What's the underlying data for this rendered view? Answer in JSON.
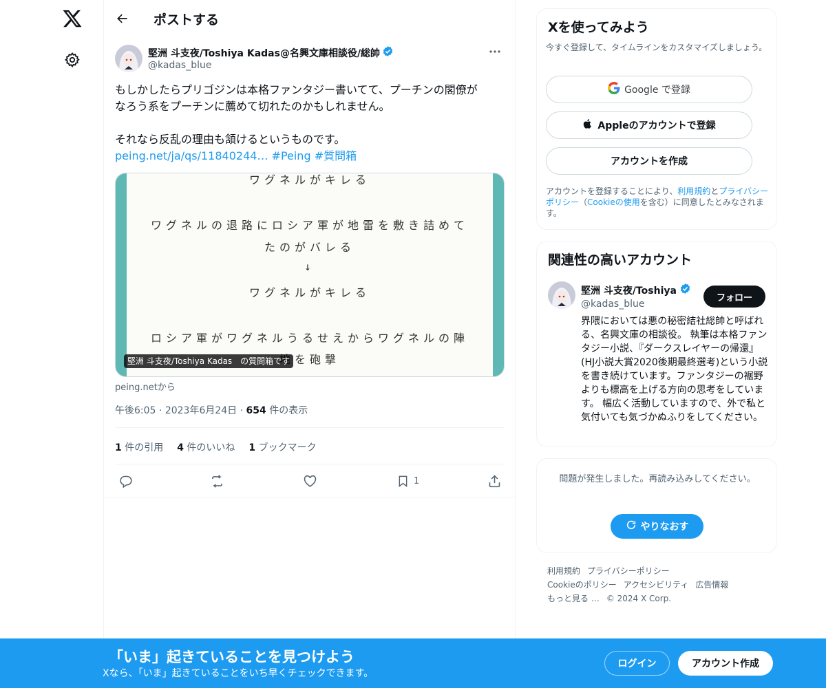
{
  "header": {
    "title": "ポストする"
  },
  "tweet": {
    "author_name": "堅洲 斗支夜/Toshiya Kadas@名興文庫相談役/総帥",
    "author_handle": "@kadas_blue",
    "text_line1": "もしかしたらプリゴジンは本格ファンタジー書いてて、プーチンの閣僚が",
    "text_line2": "なろう系をプーチンに薦めて切れたのかもしれません。",
    "text_line3": "それなら反乱の理由も頷けるというものです。",
    "link": "peing.net/ja/qs/11840244…",
    "hashtag1": "#Peing",
    "hashtag2": "#質問箱",
    "card": {
      "hw_lines": [
        "ワグネルがキレる",
        "ワグネルの退路にロシア軍が地雷を敷き詰めて",
        "たのがバレる",
        "↓",
        "ワグネルがキレる",
        "ロシア軍がワグネルうるせえからワグネルの陣",
        "地を砲撃"
      ],
      "caption": "堅洲 斗支夜/Toshiya Kadas　の質問箱です",
      "source": "peing.netから"
    },
    "time": "午後6:05",
    "date": "2023年6月24日",
    "views_count": "654",
    "views_label": "件の表示",
    "quotes_count": "1",
    "quotes_label": "件の引用",
    "likes_count": "4",
    "likes_label": "件のいいね",
    "bookmarks_count": "1",
    "bookmarks_label": "ブックマーク",
    "action_bookmark_count": "1"
  },
  "signup_panel": {
    "title": "Xを使ってみよう",
    "subtitle": "今すぐ登録して、タイムラインをカスタマイズしましょう。",
    "google_label": "Google で登録",
    "apple_label": "Appleのアカウントで登録",
    "create_label": "アカウントを作成",
    "legal_pre": "アカウントを登録することにより、",
    "legal_terms": "利用規約",
    "legal_and": "と",
    "legal_privacy": "プライバシーポリシー",
    "legal_paren_open": "（",
    "legal_cookie": "Cookieの使用",
    "legal_post": "を含む）に同意したとみなされます。"
  },
  "related_panel": {
    "title": "関連性の高いアカウント",
    "name": "堅洲 斗支夜/Toshiya",
    "handle": "@kadas_blue",
    "follow_label": "フォロー",
    "bio": "界隈においては悪の秘密結社総帥と呼ばれる、名興文庫の相談役。 執筆は本格ファンタジー小説、『ダークスレイヤーの帰還』(HJ小説大賞2020後期最終選考)という小説を書き続けています。ファンタジーの裾野よりも標高を上げる方向の思考をしています。 幅広く活動していますので、外で私と気付いても気づかぬふりをしてください。"
  },
  "error_panel": {
    "text": "問題が発生しました。再読み込みしてください。",
    "retry_label": "やりなおす"
  },
  "footer": {
    "terms": "利用規約",
    "privacy": "プライバシーポリシー",
    "cookie": "Cookieのポリシー",
    "accessibility": "アクセシビリティ",
    "ads": "広告情報",
    "more": "もっと見る …",
    "copyright": "© 2024 X Corp."
  },
  "bottom_bar": {
    "title": "「いま」起きていることを見つけよう",
    "subtitle": "Xなら、「いま」起きていることをいち早くチェックできます。",
    "login_label": "ログイン",
    "signup_label": "アカウント作成"
  },
  "colors": {
    "accent": "#1d9bf0",
    "text": "#0f1419",
    "muted": "#536471",
    "card_frame": "#5fb8b3"
  },
  "icons": [
    "x-logo-icon",
    "gear-icon",
    "back-arrow-icon",
    "verified-badge-icon",
    "more-icon",
    "reply-icon",
    "repost-icon",
    "like-icon",
    "bookmark-icon",
    "share-icon",
    "google-icon",
    "apple-icon",
    "refresh-icon"
  ]
}
